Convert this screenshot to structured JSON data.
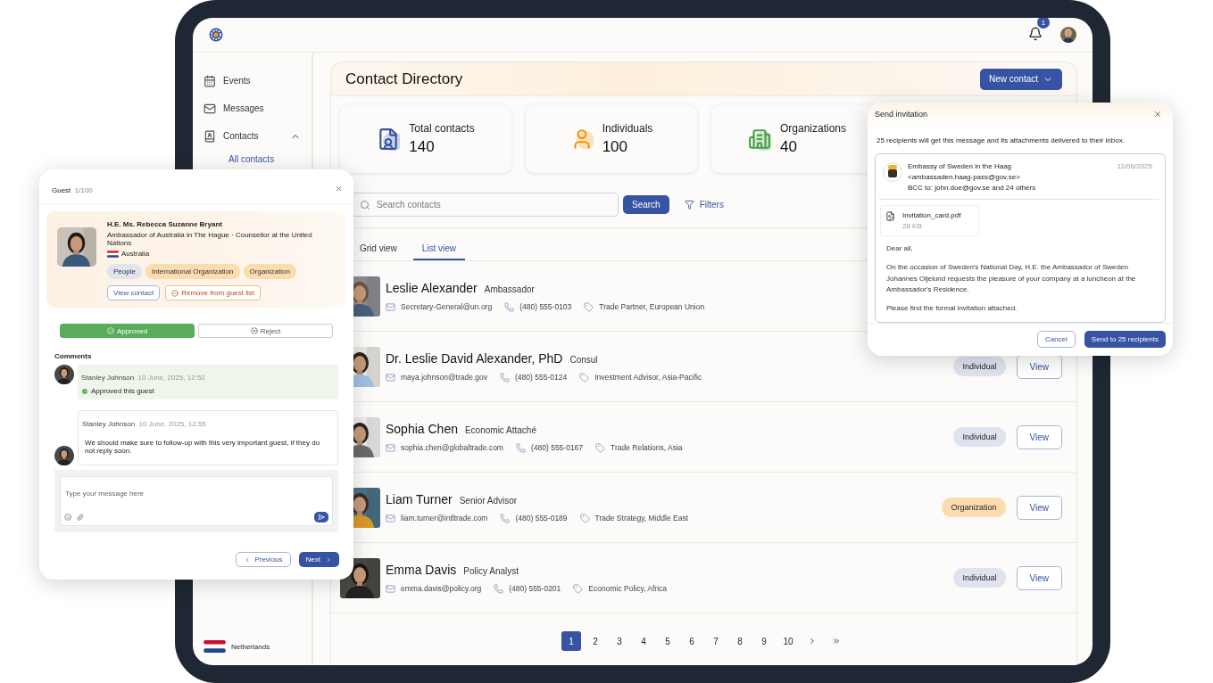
{
  "header": {
    "notifications": "1"
  },
  "sidebar": {
    "items": [
      {
        "label": "Events",
        "kind": "calendar",
        "selected": false
      },
      {
        "label": "Messages",
        "kind": "mail",
        "selected": false
      },
      {
        "label": "Contacts",
        "kind": "contacts",
        "selected": false,
        "expanded": true,
        "children": [
          {
            "label": "All contacts",
            "selected": true
          }
        ]
      }
    ],
    "country": "Netherlands"
  },
  "directory": {
    "title": "Contact Directory",
    "new_button": "New contact",
    "stats": [
      {
        "label": "Total contacts",
        "value": "140",
        "kind": "document"
      },
      {
        "label": "Individuals",
        "value": "100",
        "kind": "person"
      },
      {
        "label": "Organizations",
        "value": "40",
        "kind": "building"
      }
    ],
    "search": {
      "placeholder": "Search contacts",
      "button": "Search",
      "filters": "Filters"
    },
    "tabs": [
      {
        "label": "Grid view",
        "selected": false
      },
      {
        "label": "List view",
        "selected": true
      }
    ],
    "rows": [
      {
        "name": "Leslie Alexander",
        "title": "Ambassador",
        "email": "Secretary-General@un.org",
        "phone": "(480) 555-0103",
        "tags": "Trade Partner, European Union"
      },
      {
        "name": "Dr. Leslie David Alexander, PhD",
        "title": "Consul",
        "email": "maya.johnson@trade.gov",
        "phone": "(480) 555-0124",
        "tags": "Investment Advisor, Asia-Pacific",
        "badge": {
          "label": "Individual",
          "color": "#dfe3ef"
        },
        "action": "View"
      },
      {
        "name": "Sophia Chen",
        "title": "Economic Attaché",
        "email": "sophia.chen@globaltrade.com",
        "phone": "(480) 555-0167",
        "tags": "Trade Relations, Asia",
        "badge": {
          "label": "Individual",
          "color": "#dfe3ef"
        },
        "action": "View"
      },
      {
        "name": "Liam Turner",
        "title": "Senior Advisor",
        "email": "liam.turner@intltrade.com",
        "phone": "(480) 555-0189",
        "tags": "Trade Strategy, Middle East",
        "badge": {
          "label": "Organization",
          "color": "#fbdcae"
        },
        "action": "View"
      },
      {
        "name": "Emma Davis",
        "title": "Policy Analyst",
        "email": "emma.davis@policy.org",
        "phone": "(480) 555-0201",
        "tags": "Economic Policy, Africa",
        "badge": {
          "label": "Individual",
          "color": "#dfe3ef"
        },
        "action": "View"
      }
    ],
    "pages": [
      {
        "label": "1",
        "selected": true
      },
      {
        "label": "2",
        "selected": false
      },
      {
        "label": "3",
        "selected": false
      },
      {
        "label": "4",
        "selected": false
      },
      {
        "label": "5",
        "selected": false
      },
      {
        "label": "6",
        "selected": false
      },
      {
        "label": "7",
        "selected": false
      },
      {
        "label": "8",
        "selected": false
      },
      {
        "label": "9",
        "selected": false
      },
      {
        "label": "10",
        "selected": false
      }
    ]
  },
  "guest_dialog": {
    "title": "Guest",
    "counter": "1/100",
    "name": "H.E. Ms. Rebecca Suzanne Bryant",
    "role": "Ambassador of Australia in The Hague · Counsellor at the United Nations",
    "country": "Australia",
    "tags": [
      {
        "label": "People",
        "color": "#e0e4f0"
      },
      {
        "label": "International Organization",
        "color": "#fbdcae"
      },
      {
        "label": "Organization",
        "color": "#fbdcae"
      }
    ],
    "view_button": "View contact",
    "remove_button": "Remove from guest list",
    "decisions": [
      {
        "label": "Approved",
        "selected": true
      },
      {
        "label": "Reject",
        "selected": false
      }
    ],
    "comments_title": "Comments",
    "comments": [
      {
        "author": "Stanley Johnson",
        "time": "10 June, 2025, 12:52",
        "text": "Approved this guest",
        "kind": "approval"
      },
      {
        "author": "Stanley Johnson",
        "time": "10 June, 2025, 12:55",
        "text": "We should make sure to follow-up with this very important guest, if they do not reply soon.",
        "kind": "message"
      }
    ],
    "message_placeholder": "Type your message here",
    "previous": "Previous",
    "next": "Next"
  },
  "invite_dialog": {
    "title": "Send invitation",
    "info": "25 recipients will get this message and its attachments delivered to their inbox.",
    "sender": "Embassy of Sweden in the Haag",
    "sender_email": "<ambassaden.haag-pass@gov.se>",
    "bcc": "BCC to: john.doe@gov.se and 24 others",
    "date": "11/06/2025",
    "attachment": {
      "name": "Invitation_card.pdf",
      "size": "28 KB"
    },
    "body": [
      "Dear all,",
      "On the occasion of Sweden's National Day, H.E. the Ambassador of Sweden Johannes Oljelund requests the pleasure of your company at a luncheon at the Ambassador's Residence.",
      "Please find the formal invitation attached."
    ],
    "cancel": "Cancel",
    "send": "Send to 25 recipients"
  }
}
